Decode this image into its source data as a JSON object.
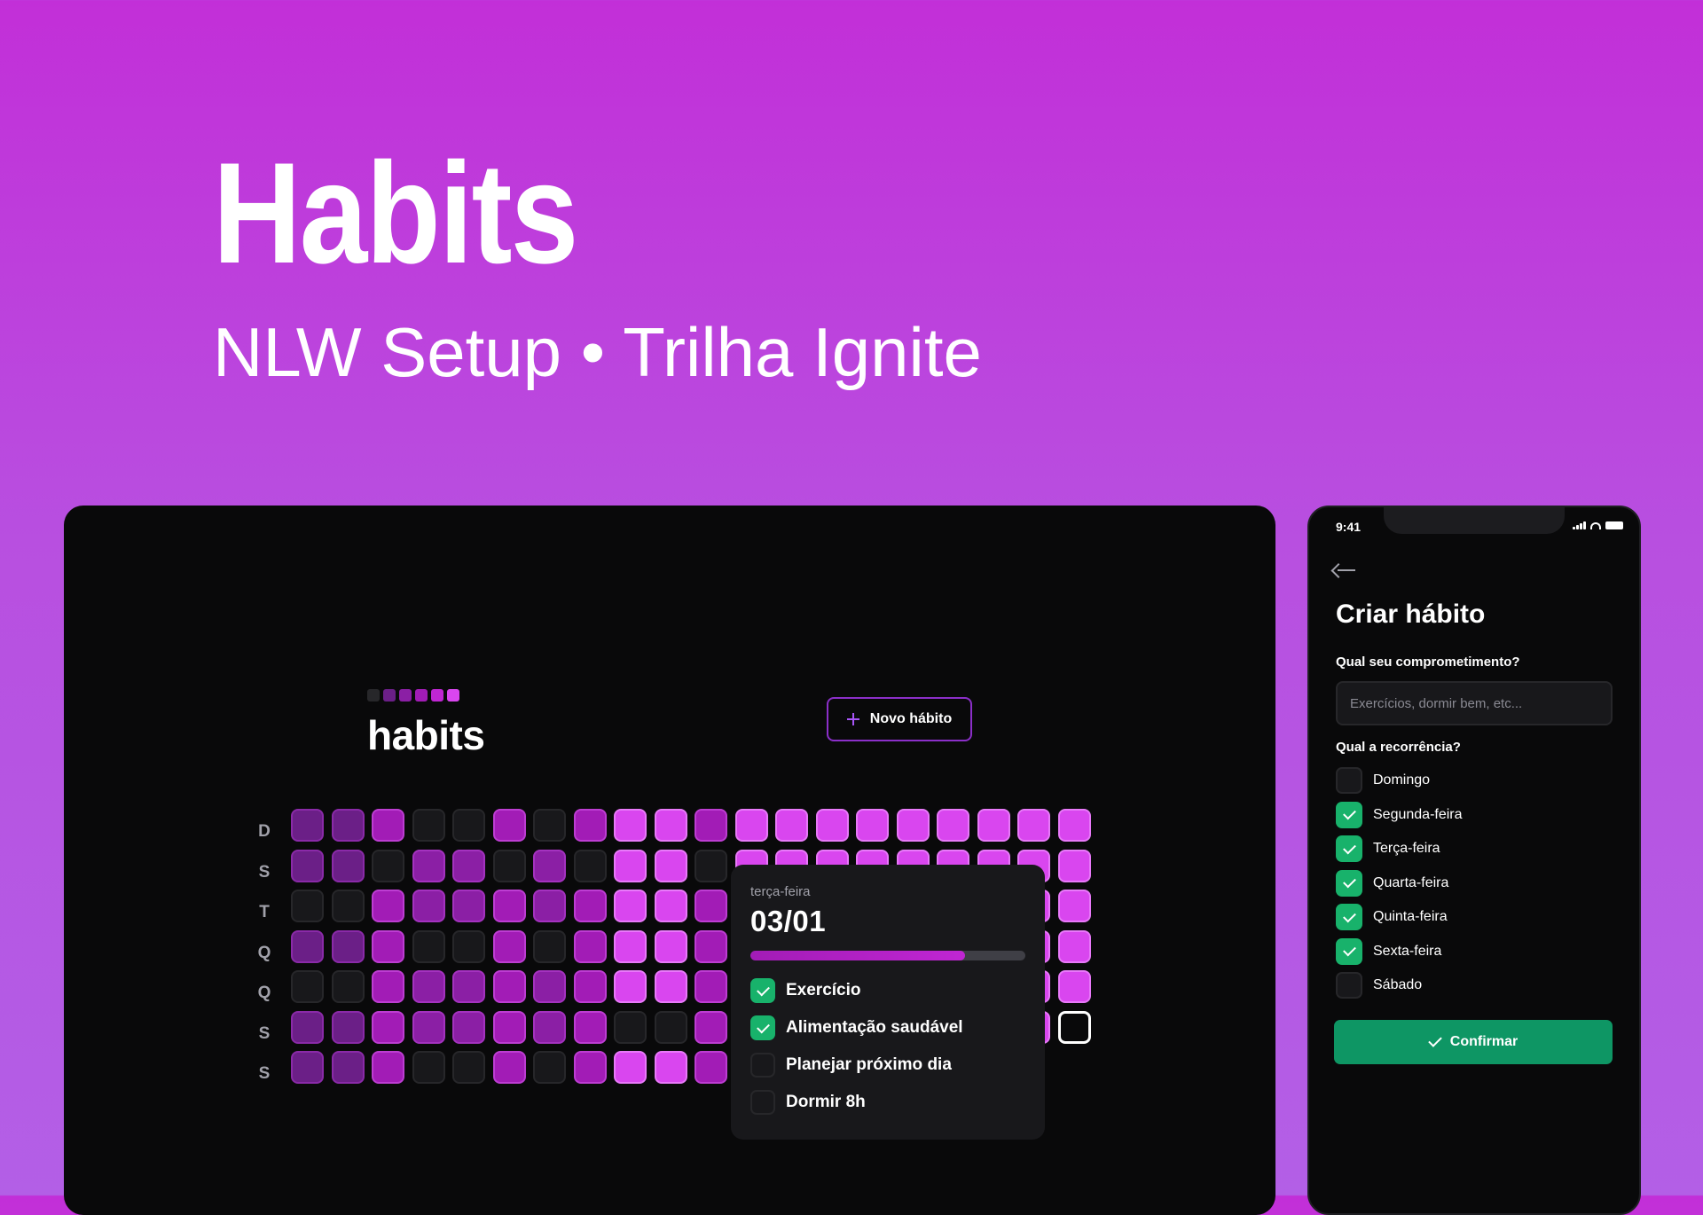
{
  "hero": {
    "title": "Habits",
    "subtitle": "NLW Setup • Trilha Ignite"
  },
  "desktop": {
    "logo": "habits",
    "logo_squares": [
      "#27272a",
      "#6b1f87",
      "#8b1fa5",
      "#a21cb6",
      "#c026d3",
      "#d946ef"
    ],
    "new_habit_label": "Novo hábito",
    "weekdays": [
      "D",
      "S",
      "T",
      "Q",
      "Q",
      "S",
      "S"
    ],
    "grid": [
      [
        1,
        1,
        3,
        0,
        0,
        3,
        0,
        3,
        4,
        4,
        3,
        4,
        4,
        4,
        4,
        4,
        4,
        4,
        4,
        4
      ],
      [
        1,
        1,
        0,
        2,
        2,
        0,
        2,
        0,
        4,
        4,
        0,
        4,
        4,
        4,
        4,
        4,
        4,
        4,
        4,
        4
      ],
      [
        0,
        0,
        3,
        2,
        2,
        3,
        2,
        3,
        4,
        4,
        3,
        4,
        4,
        4,
        4,
        4,
        4,
        4,
        4,
        4
      ],
      [
        1,
        1,
        3,
        0,
        0,
        3,
        0,
        3,
        4,
        4,
        3,
        4,
        4,
        4,
        4,
        4,
        4,
        4,
        4,
        4
      ],
      [
        0,
        0,
        3,
        2,
        2,
        3,
        2,
        3,
        4,
        4,
        3,
        4,
        4,
        4,
        4,
        4,
        4,
        4,
        4,
        4
      ],
      [
        1,
        1,
        3,
        2,
        2,
        3,
        2,
        3,
        0,
        0,
        3,
        4,
        4,
        4,
        4,
        4,
        4,
        4,
        4,
        5
      ],
      [
        1,
        1,
        3,
        0,
        0,
        3,
        0,
        3,
        4,
        4,
        3,
        4,
        4,
        4,
        4,
        4,
        4,
        4,
        -1,
        -1
      ]
    ],
    "popover": {
      "weekday": "terça-feira",
      "date": "03/01",
      "progress": 0.78,
      "habits": [
        {
          "label": "Exercício",
          "checked": true
        },
        {
          "label": "Alimentação saudável",
          "checked": true
        },
        {
          "label": "Planejar próximo dia",
          "checked": false
        },
        {
          "label": "Dormir 8h",
          "checked": false
        }
      ]
    }
  },
  "phone": {
    "time": "9:41",
    "title": "Criar hábito",
    "commitment_label": "Qual seu comprometimento?",
    "commitment_placeholder": "Exercícios, dormir bem, etc...",
    "recurrence_label": "Qual a recorrência?",
    "days": [
      {
        "label": "Domingo",
        "checked": false
      },
      {
        "label": "Segunda-feira",
        "checked": true
      },
      {
        "label": "Terça-feira",
        "checked": true
      },
      {
        "label": "Quarta-feira",
        "checked": true
      },
      {
        "label": "Quinta-feira",
        "checked": true
      },
      {
        "label": "Sexta-feira",
        "checked": true
      },
      {
        "label": "Sábado",
        "checked": false
      }
    ],
    "confirm_label": "Confirmar"
  },
  "colors": {
    "accent": "#a21cb6",
    "brand_purple": "#8b5cf6",
    "success": "#16a34a"
  }
}
